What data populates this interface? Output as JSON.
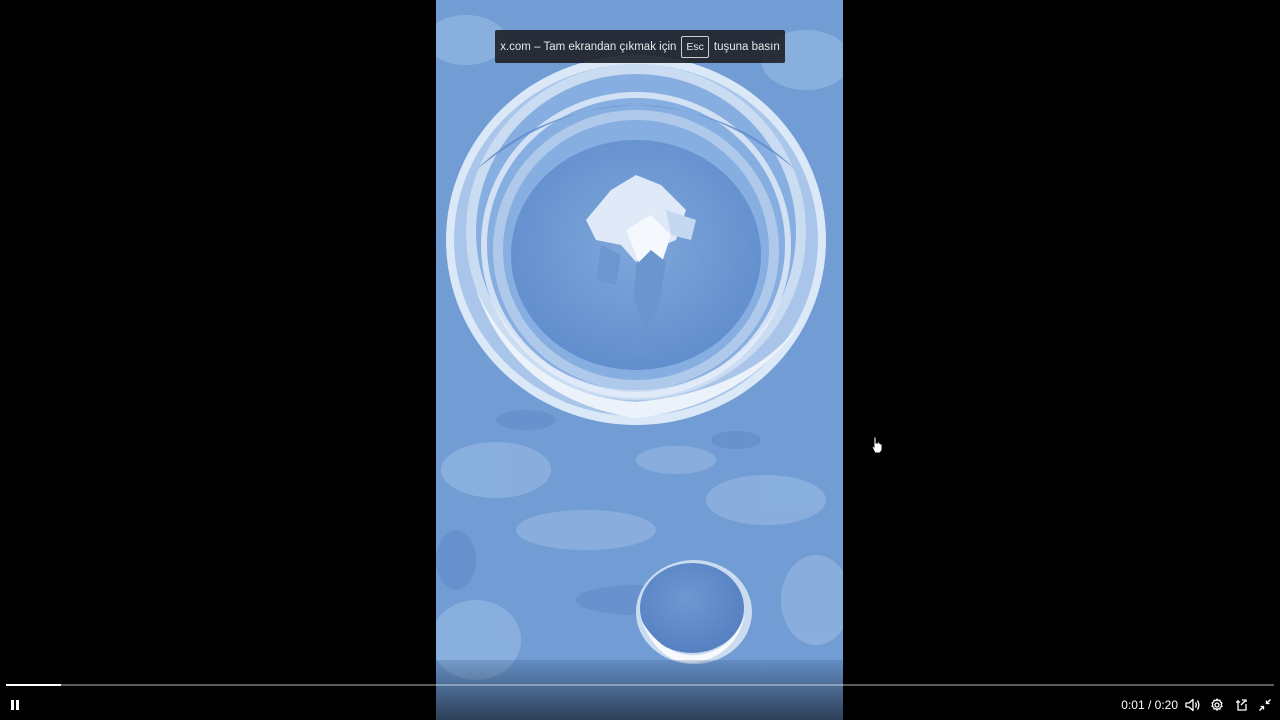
{
  "toast": {
    "text_before": "x.com – Tam ekrandan çıkmak için",
    "key": "Esc",
    "text_after": "tuşuna basın"
  },
  "player": {
    "current_time": "0:01",
    "separator": " / ",
    "duration": "0:20",
    "progress": 0.043
  },
  "icons": {
    "pause": "pause-icon",
    "volume": "volume-icon",
    "settings": "gear-icon",
    "pip": "picture-in-picture-icon",
    "exit_fullscreen": "exit-fullscreen-icon",
    "cursor": "hand-cursor-icon"
  },
  "colors": {
    "background": "#000000",
    "moon_surface": "#6f9bd3",
    "toast_bg": "#20242a",
    "progress_fill": "#ffffff"
  }
}
